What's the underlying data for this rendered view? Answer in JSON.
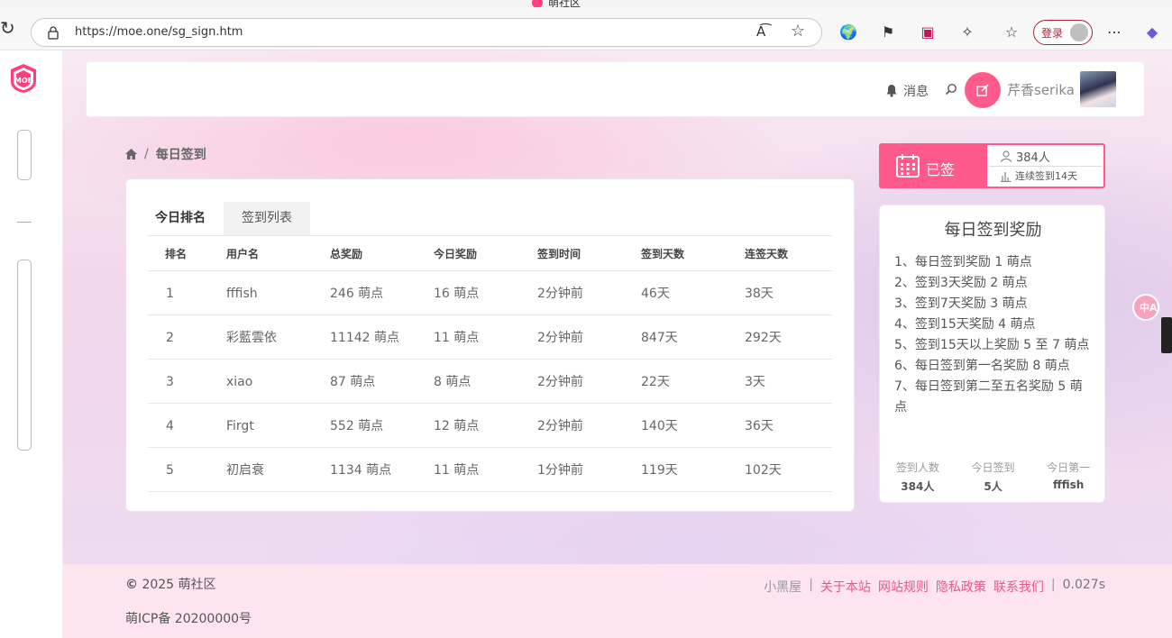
{
  "window": {
    "title": "萌社区"
  },
  "browser": {
    "url": "https://moe.one/sg_sign.htm",
    "login_label": "登录"
  },
  "nav": {
    "messages_label": "消息",
    "username": "芹香serika"
  },
  "breadcrumb": {
    "current": "每日签到",
    "separator": "/"
  },
  "tabs": [
    {
      "label": "今日排名",
      "active": true
    },
    {
      "label": "签到列表",
      "active": false
    }
  ],
  "table": {
    "headers": [
      "排名",
      "用户名",
      "总奖励",
      "今日奖励",
      "签到时间",
      "签到天数",
      "连签天数"
    ],
    "rows": [
      [
        "1",
        "fffish",
        "246 萌点",
        "16 萌点",
        "2分钟前",
        "46天",
        "38天"
      ],
      [
        "2",
        "彩藍雲依",
        "11142 萌点",
        "11 萌点",
        "2分钟前",
        "847天",
        "292天"
      ],
      [
        "3",
        "xiao",
        "87 萌点",
        "8 萌点",
        "2分钟前",
        "22天",
        "3天"
      ],
      [
        "4",
        "Firgt",
        "552 萌点",
        "12 萌点",
        "2分钟前",
        "140天",
        "36天"
      ],
      [
        "5",
        "初启衰",
        "1134 萌点",
        "11 萌点",
        "1分钟前",
        "119天",
        "102天"
      ]
    ]
  },
  "sign": {
    "status": "已签",
    "people": "384人",
    "streak": "连续签到14天"
  },
  "reward": {
    "title": "每日签到奖励",
    "rules": [
      "1、每日签到奖励 1 萌点",
      "2、签到3天奖励 2 萌点",
      "3、签到7天奖励 3 萌点",
      "4、签到15天奖励 4 萌点",
      "5、签到15天以上奖励 5 至 7 萌点",
      "6、每日签到第一名奖励 8 萌点",
      "7、每日签到第二至五名奖励 5 萌点"
    ],
    "stats": [
      {
        "label": "签到人数",
        "value": "384人"
      },
      {
        "label": "今日签到",
        "value": "5人"
      },
      {
        "label": "今日第一",
        "value": "fffish"
      }
    ]
  },
  "footer": {
    "copyright": "2025 萌社区",
    "icp": "萌ICP备 20200000号",
    "links": [
      "小黑屋",
      "关于本站",
      "网站规则",
      "隐私政策",
      "联系我们"
    ],
    "divider": "|",
    "timing": "0.027s"
  },
  "colors": {
    "accent": "#ff5a8a",
    "footer_bg": "#fde4ef",
    "link": "#e8578a"
  }
}
